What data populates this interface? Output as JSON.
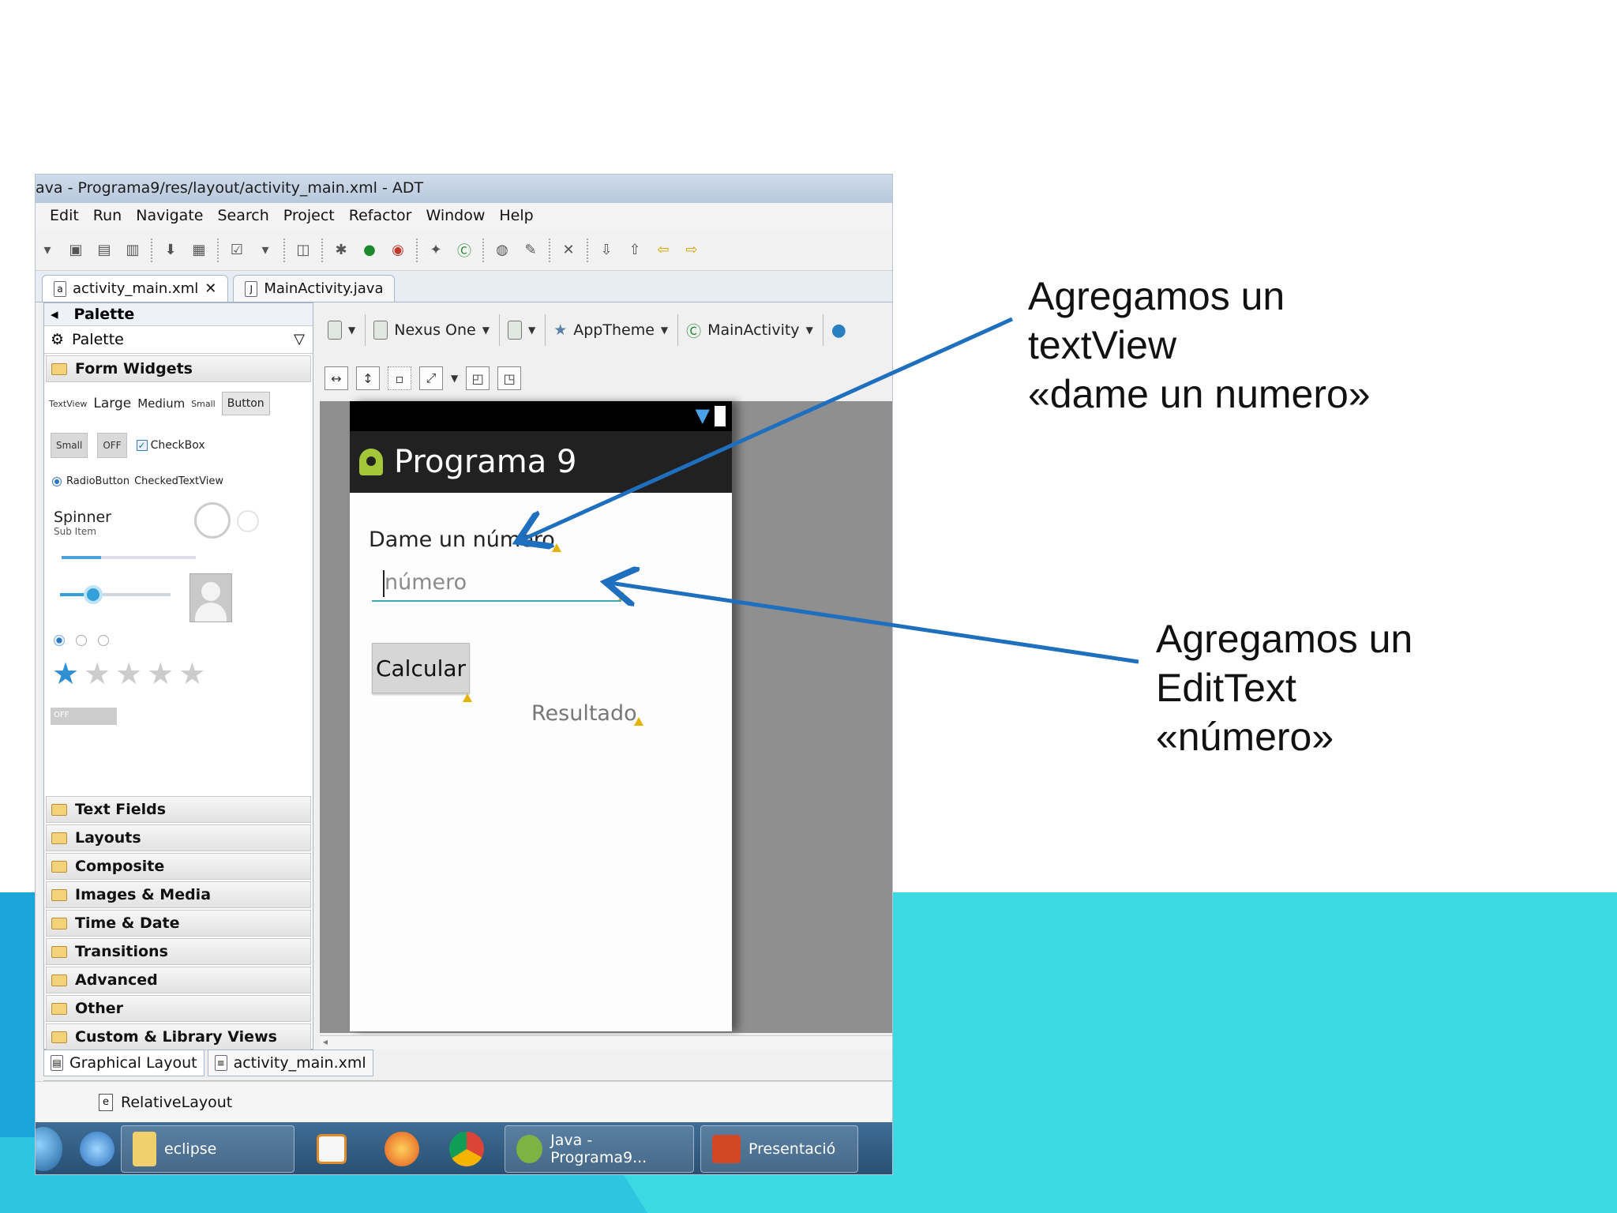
{
  "window": {
    "title": "ava - Programa9/res/layout/activity_main.xml - ADT"
  },
  "menu": [
    "Edit",
    "Run",
    "Navigate",
    "Search",
    "Project",
    "Refactor",
    "Window",
    "Help"
  ],
  "editor_tabs": [
    {
      "label": "activity_main.xml",
      "active": true
    },
    {
      "label": "MainActivity.java",
      "active": false
    }
  ],
  "palette": {
    "header": "Palette",
    "selector": "Palette",
    "open_category": "Form Widgets",
    "widgets": {
      "textview_small": "TextView",
      "large": "Large",
      "medium": "Medium",
      "small": "Small",
      "button": "Button",
      "small_button": "Small",
      "toggle": "OFF",
      "checkbox": "CheckBox",
      "radiobutton": "RadioButton",
      "checkedtextview": "CheckedTextView",
      "spinner": "Spinner",
      "spinner_sub": "Sub Item",
      "switch_off": "OFF",
      "progress_fraction": 0.3,
      "seekbar_fraction": 0.3,
      "rating": 1,
      "rating_max": 5
    },
    "categories": [
      "Text Fields",
      "Layouts",
      "Composite",
      "Images & Media",
      "Time & Date",
      "Transitions",
      "Advanced",
      "Other",
      "Custom & Library Views"
    ]
  },
  "designer_toolbar": {
    "device": "Nexus One",
    "theme": "AppTheme",
    "activity": "MainActivity"
  },
  "phone": {
    "app_title": "Programa 9",
    "textview_label": "Dame un número",
    "edit_placeholder": "número",
    "button_label": "Calcular",
    "result_label": "Resultado"
  },
  "bottom_tabs": [
    "Graphical Layout",
    "activity_main.xml"
  ],
  "outline": {
    "item": "RelativeLayout"
  },
  "taskbar": {
    "eclipse": "eclipse",
    "java": "Java - Programa9...",
    "presentacion": "Presentació"
  },
  "annotations": {
    "first": [
      "Agregamos un",
      "textView",
      "«dame un numero»"
    ],
    "second": [
      "Agregamos un",
      "EditText",
      "«número»"
    ]
  },
  "colors": {
    "accent_band": "#3cd9e3",
    "arrow": "#1f6fbf"
  }
}
